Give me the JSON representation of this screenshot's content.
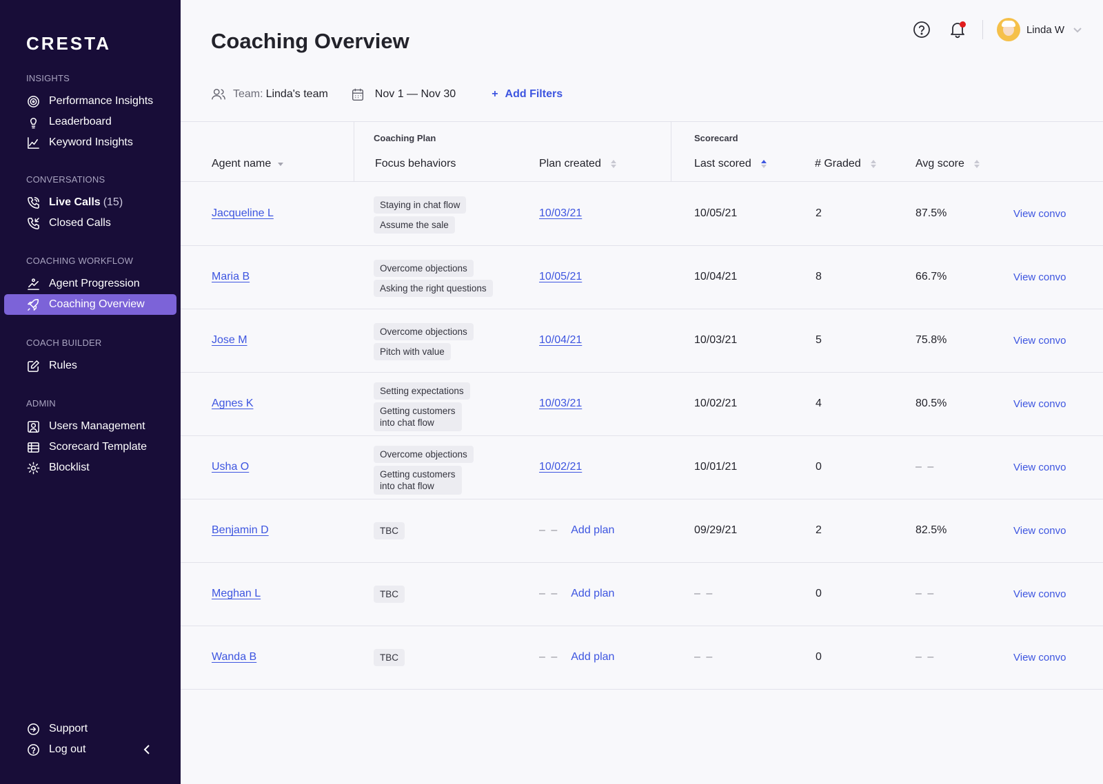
{
  "brand": {
    "logo": "CRESTA"
  },
  "sidebar": {
    "sections": [
      {
        "heading": "INSIGHTS",
        "items": [
          {
            "label": "Performance Insights",
            "icon": "target-icon"
          },
          {
            "label": "Leaderboard",
            "icon": "lightbulb-icon"
          },
          {
            "label": "Keyword Insights",
            "icon": "line-chart-icon"
          }
        ]
      },
      {
        "heading": "CONVERSATIONS",
        "items": [
          {
            "label": "Live Calls",
            "count": "(15)",
            "icon": "phone-icon"
          },
          {
            "label": "Closed Calls",
            "icon": "phone-incoming-icon"
          }
        ]
      },
      {
        "heading": "COACHING WORKFLOW",
        "items": [
          {
            "label": "Agent Progression",
            "icon": "progression-icon"
          },
          {
            "label": "Coaching Overview",
            "icon": "rocket-icon",
            "active": true
          }
        ]
      },
      {
        "heading": "COACH BUILDER",
        "items": [
          {
            "label": "Rules",
            "icon": "edit-icon"
          }
        ]
      },
      {
        "heading": "ADMIN",
        "items": [
          {
            "label": "Users Management",
            "icon": "user-square-icon"
          },
          {
            "label": "Scorecard Template",
            "icon": "table-icon"
          },
          {
            "label": "Blocklist",
            "icon": "gear-icon"
          }
        ]
      }
    ],
    "bottom": [
      {
        "label": "Support",
        "icon": "support-icon"
      },
      {
        "label": "Log out",
        "icon": "help-circle-icon"
      }
    ]
  },
  "header": {
    "title": "Coaching Overview",
    "user_name": "Linda W"
  },
  "filters": {
    "team_label": "Team:",
    "team_value": "Linda's team",
    "date_range": "Nov 1 — Nov 30",
    "add_filters": "Add Filters",
    "add_plus": "+"
  },
  "table": {
    "groups": {
      "coaching_plan": "Coaching Plan",
      "scorecard": "Scorecard"
    },
    "columns": {
      "agent": "Agent name",
      "focus": "Focus behaviors",
      "plan_created": "Plan created",
      "last_scored": "Last scored",
      "graded": "# Graded",
      "avg": "Avg score"
    },
    "action_label": "View convo",
    "add_plan_label": "Add plan",
    "empty": "– –",
    "rows": [
      {
        "agent": "Jacqueline L",
        "tags": [
          "Staying in chat flow",
          "Assume the sale"
        ],
        "plan_created": "10/03/21",
        "last_scored": "10/05/21",
        "graded": "2",
        "avg": "87.5%"
      },
      {
        "agent": "Maria B",
        "tags": [
          "Overcome objections",
          "Asking the right questions"
        ],
        "plan_created": "10/05/21",
        "last_scored": "10/04/21",
        "graded": "8",
        "avg": "66.7%"
      },
      {
        "agent": "Jose M",
        "tags": [
          "Overcome objections",
          "Pitch with value"
        ],
        "plan_created": "10/04/21",
        "last_scored": "10/03/21",
        "graded": "5",
        "avg": "75.8%"
      },
      {
        "agent": "Agnes K",
        "tags": [
          "Setting expectations",
          "Getting customers\ninto chat flow"
        ],
        "plan_created": "10/03/21",
        "last_scored": "10/02/21",
        "graded": "4",
        "avg": "80.5%"
      },
      {
        "agent": "Usha O",
        "tags": [
          "Overcome objections",
          "Getting customers\ninto chat flow"
        ],
        "plan_created": "10/02/21",
        "last_scored": "10/01/21",
        "graded": "0",
        "avg": "– –"
      },
      {
        "agent": "Benjamin D",
        "tags": [
          "TBC"
        ],
        "plan_created": "",
        "last_scored": "09/29/21",
        "graded": "2",
        "avg": "82.5%"
      },
      {
        "agent": "Meghan L",
        "tags": [
          "TBC"
        ],
        "plan_created": "",
        "last_scored": "– –",
        "graded": "0",
        "avg": "– –"
      },
      {
        "agent": "Wanda B",
        "tags": [
          "TBC"
        ],
        "plan_created": "",
        "last_scored": "– –",
        "graded": "0",
        "avg": "– –"
      }
    ]
  },
  "colors": {
    "sidebar_bg": "#180d38",
    "active_bg": "#7c63d8",
    "accent": "#3d55e0",
    "notif_dot": "#e11d1d"
  }
}
